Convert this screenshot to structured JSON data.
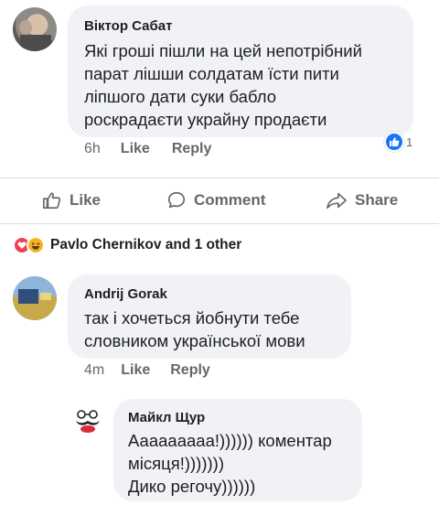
{
  "comment1": {
    "author": "Віктор Сабат",
    "text": "Які гроші пішли на цей непотрібний\nпарат лішши солдатам їсти пити\nліпшого дати суки бабло\nроскрадаєти украйну продаєти",
    "time": "6h",
    "like": "Like",
    "reply": "Reply",
    "reaction_count": "1"
  },
  "actions": {
    "like": "Like",
    "comment": "Comment",
    "share": "Share"
  },
  "reactions": {
    "text": "Pavlo Chernikov and 1 other"
  },
  "comment2": {
    "author": "Andrij Gorak",
    "text": "так і хочеться йобнути тебе\nсловником української мови",
    "time": "4m",
    "like": "Like",
    "reply": "Reply"
  },
  "comment3": {
    "author": "Майкл Щур",
    "text": "Аааааааaa!)))))) коментар\nмісяця!)))))))\nДико регочу))))))"
  },
  "colors": {
    "bubble": "#f0f2f5",
    "like_blue": "#1877f2",
    "muted": "#65676b",
    "love_red": "#f33e58",
    "haha_yellow": "#f7b125"
  }
}
